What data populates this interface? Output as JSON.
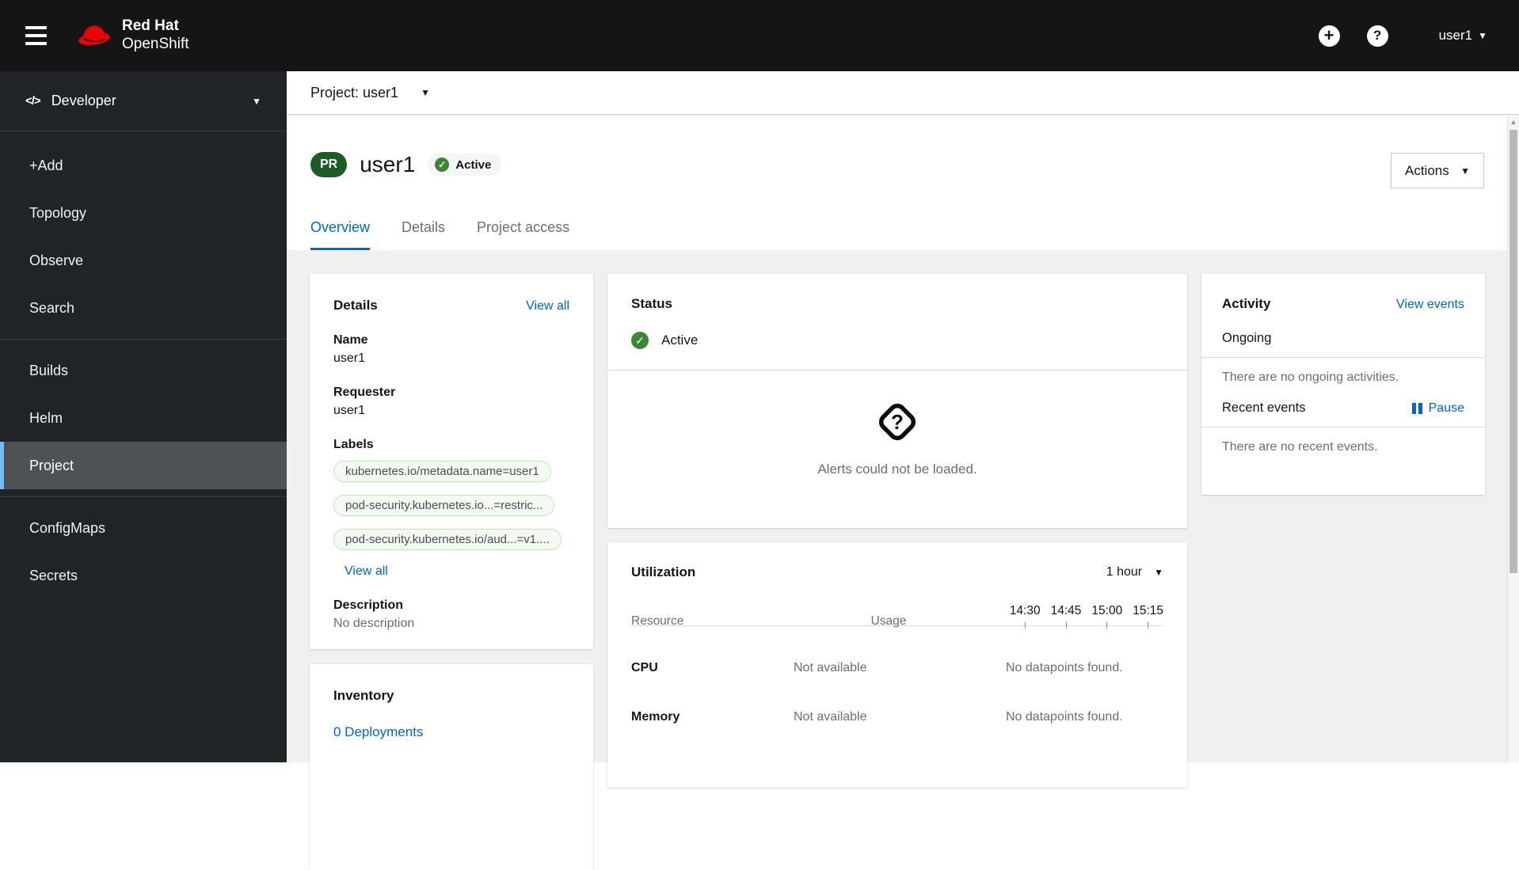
{
  "masthead": {
    "brand_line1": "Red Hat",
    "brand_line2": "OpenShift",
    "username": "user1"
  },
  "sidebar": {
    "perspective": "Developer",
    "groups": [
      {
        "items": [
          {
            "label": "+Add"
          },
          {
            "label": "Topology"
          },
          {
            "label": "Observe"
          },
          {
            "label": "Search"
          }
        ]
      },
      {
        "items": [
          {
            "label": "Builds"
          },
          {
            "label": "Helm"
          },
          {
            "label": "Project"
          }
        ]
      },
      {
        "items": [
          {
            "label": "ConfigMaps"
          },
          {
            "label": "Secrets"
          }
        ]
      }
    ]
  },
  "project_bar": {
    "label": "Project: user1"
  },
  "page_header": {
    "badge": "PR",
    "title": "user1",
    "status": "Active",
    "actions_label": "Actions"
  },
  "tabs": [
    {
      "label": "Overview"
    },
    {
      "label": "Details"
    },
    {
      "label": "Project access"
    }
  ],
  "details_card": {
    "title": "Details",
    "view_all": "View all",
    "name_label": "Name",
    "name_value": "user1",
    "requester_label": "Requester",
    "requester_value": "user1",
    "labels_label": "Labels",
    "labels": [
      "kubernetes.io/metadata.name=user1",
      "pod-security.kubernetes.io...=restric...",
      "pod-security.kubernetes.io/aud...=v1...."
    ],
    "labels_view_all": "View all",
    "description_label": "Description",
    "description_value": "No description"
  },
  "status_card": {
    "title": "Status",
    "status": "Active",
    "alerts_message": "Alerts could not be loaded."
  },
  "utilization_card": {
    "title": "Utilization",
    "duration": "1 hour",
    "resource_header": "Resource",
    "usage_header": "Usage",
    "times": [
      "14:30",
      "14:45",
      "15:00",
      "15:15"
    ],
    "rows": [
      {
        "resource": "CPU",
        "usage": "Not available",
        "datapoints": "No datapoints found."
      },
      {
        "resource": "Memory",
        "usage": "Not available",
        "datapoints": "No datapoints found."
      }
    ]
  },
  "inventory_card": {
    "title": "Inventory",
    "deployments_link": "0 Deployments"
  },
  "activity_card": {
    "title": "Activity",
    "view_events": "View events",
    "ongoing_label": "Ongoing",
    "ongoing_empty": "There are no ongoing activities.",
    "recent_label": "Recent events",
    "pause_label": "Pause",
    "recent_empty": "There are no recent events."
  },
  "icons": {
    "plus": "+",
    "question": "?",
    "caret_down": "▾",
    "caret_down_solid": "▼",
    "check": "✓",
    "scroll_up_arrow": "▲",
    "developer_code": "</>"
  },
  "colors": {
    "brand_red": "#ee0000",
    "link_blue": "#0066cc",
    "success_green": "#3e8635",
    "project_badge_green": "#1e5b26",
    "label_green_bg": "#f3faf2",
    "label_green_border": "#bde5b9",
    "nav_active_accent": "#73bcf7",
    "masthead_bg": "#151515",
    "sidebar_bg": "#212427",
    "content_bg": "#f0f0f0"
  }
}
